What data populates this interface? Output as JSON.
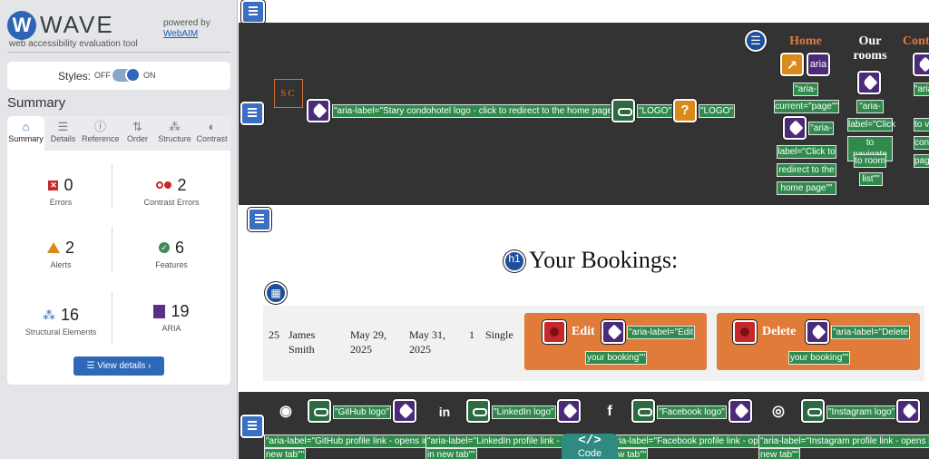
{
  "wave": {
    "brand_name": "WAVE",
    "brand_sub": "web accessibility evaluation tool",
    "powered_by": "powered by",
    "powered_link": "WebAIM",
    "styles_label": "Styles:",
    "styles_off": "OFF",
    "styles_on": "ON",
    "styles_state": "on",
    "summary_title": "Summary",
    "tabs": [
      {
        "label": "Summary",
        "icon": "home-icon"
      },
      {
        "label": "Details",
        "icon": "list-icon"
      },
      {
        "label": "Reference",
        "icon": "info-icon"
      },
      {
        "label": "Order",
        "icon": "order-icon"
      },
      {
        "label": "Structure",
        "icon": "structure-icon"
      },
      {
        "label": "Contrast",
        "icon": "contrast-icon"
      }
    ],
    "active_tab": "Summary",
    "stats": {
      "errors": {
        "value": "0",
        "label": "Errors"
      },
      "contrast": {
        "value": "2",
        "label": "Contrast Errors"
      },
      "alerts": {
        "value": "2",
        "label": "Alerts"
      },
      "features": {
        "value": "6",
        "label": "Features"
      },
      "structural": {
        "value": "16",
        "label": "Structural Elements"
      },
      "aria": {
        "value": "19",
        "label": "ARIA"
      }
    },
    "view_details": "View details ›"
  },
  "page": {
    "logo_text": "SC",
    "header_labels": {
      "logo_aria": "\"aria-label=\"Stary condohotel logo - click to redirect to the home page\"\"",
      "logo_alt1": "\"LOGO\"",
      "logo_alt2": "\"LOGO\""
    },
    "nav": [
      {
        "label": "Home",
        "color": "#e07b39",
        "sub": [
          "\"aria-",
          "current=\"page\"\"",
          "\"aria-",
          "label=\"Click to",
          "redirect to the",
          "home page\"\""
        ]
      },
      {
        "label_line1": "Our",
        "label_line2": "rooms",
        "color": "#ffffff",
        "sub": [
          "\"aria-",
          "label=\"Click",
          "to navigate",
          "to room",
          "list\"\""
        ]
      },
      {
        "label": "Cont",
        "color": "#e07b39",
        "sub": [
          "\"aria-",
          "to vi",
          "conta",
          "page"
        ]
      }
    ],
    "heading_badge": "h1",
    "heading": "Your Bookings:",
    "booking": {
      "id": "25",
      "name_line1": "James",
      "name_line2": "Smith",
      "checkin_line1": "May 29,",
      "checkin_line2": "2025",
      "checkout_line1": "May 31,",
      "checkout_line2": "2025",
      "guests": "1",
      "room": "Single",
      "edit_label": "Edit",
      "edit_aria_line1": "\"aria-label=\"Edit",
      "edit_aria_line2": "your booking\"\"",
      "delete_label": "Delete",
      "delete_aria_line1": "\"aria-label=\"Delete",
      "delete_aria_line2": "your booking\"\""
    },
    "footer": {
      "social": [
        {
          "icon": "github-icon",
          "alt": "\"GitHub logo\"",
          "aria_line1": "\"aria-label=\"GitHub profile link - opens in",
          "aria_line2": "new tab\"\""
        },
        {
          "icon": "linkedin-icon",
          "alt": "\"LinkedIn logo\"",
          "aria_line1": "\"aria-label=\"LinkedIn profile link - opens",
          "aria_line2": "in new tab\"\""
        },
        {
          "icon": "facebook-icon",
          "alt": "\"Facebook logo\"",
          "aria_line1": "\"aria-label=\"Facebook profile link - opens",
          "aria_line2": "new tab\"\""
        },
        {
          "icon": "instagram-icon",
          "alt": "\"Instagram logo\"",
          "aria_line1": "\"aria-label=\"Instagram profile link - opens in",
          "aria_line2": "new tab\"\""
        }
      ],
      "code_label": "Code",
      "code_glyph": "</>"
    },
    "colors": {
      "header_bg": "#333333",
      "accent": "#e07b39",
      "wave_blue": "#2e68b8",
      "label_green": "#2f8a4c",
      "aria_purple": "#4b2a7a"
    }
  }
}
